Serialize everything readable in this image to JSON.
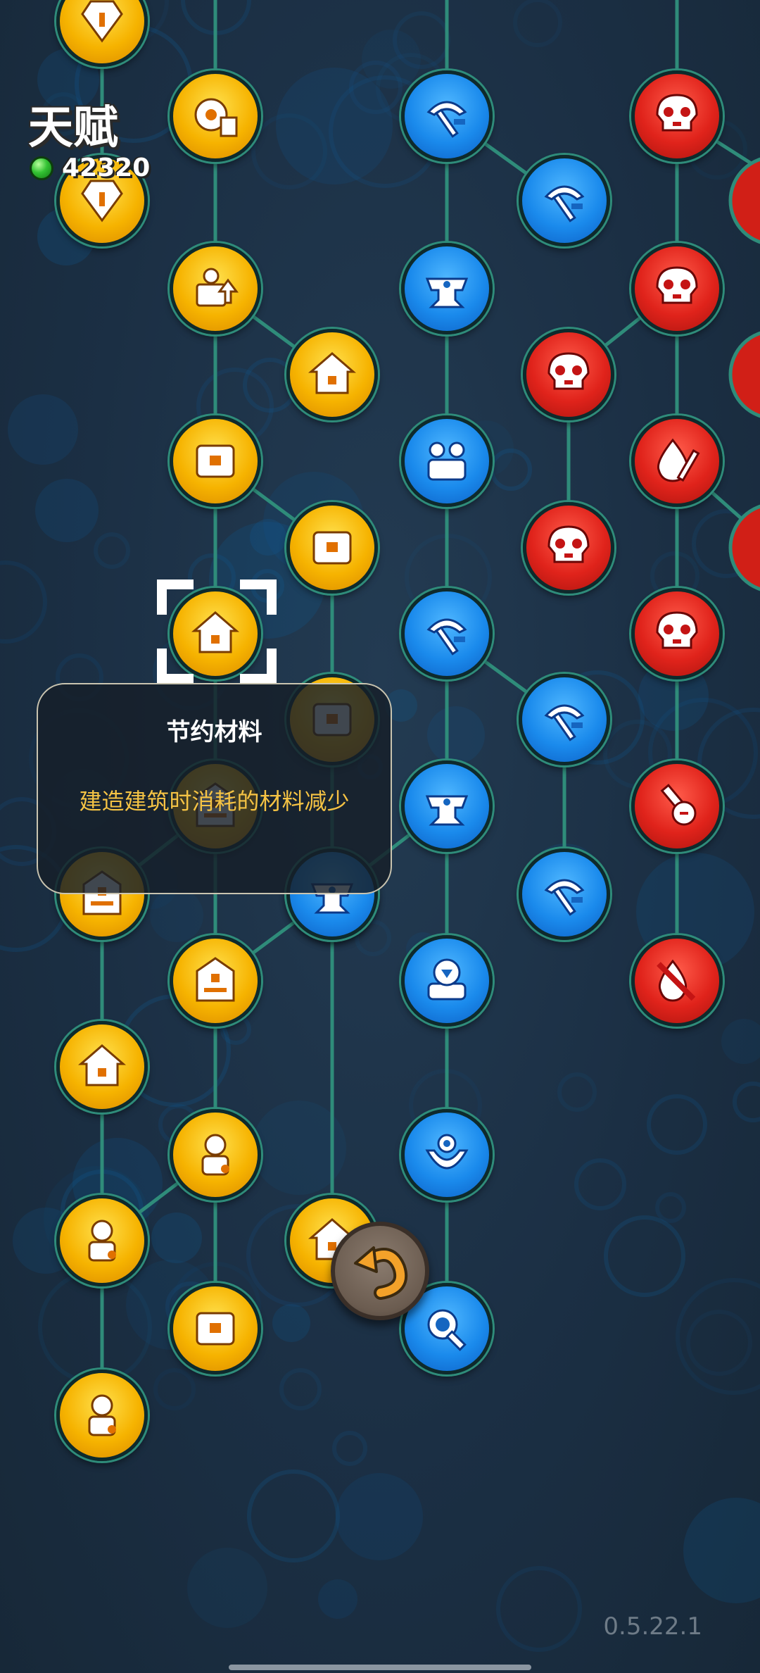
{
  "header": {
    "title": "天赋",
    "currency_icon": "green-gem-icon",
    "currency_value": "42320"
  },
  "tooltip": {
    "title": "节约材料",
    "description": "建造建筑时消耗的材料减少"
  },
  "version": "0.5.22.1",
  "colors": {
    "gold": "#f6b300",
    "blue": "#1a8aec",
    "red": "#e0231b",
    "link": "#2f8c7a",
    "tooltip_desc": "#f5c344"
  },
  "back_button": {
    "icon": "undo-arrow-icon"
  },
  "talents": [
    {
      "id": "g1",
      "color": "gold",
      "icon": "gem-bonus-icon"
    },
    {
      "id": "g2",
      "color": "gold",
      "icon": "gem-bonus-icon"
    },
    {
      "id": "g3",
      "color": "gold",
      "icon": "gear-exp-icon"
    },
    {
      "id": "g4",
      "color": "gold",
      "icon": "wood-bonus-icon"
    },
    {
      "id": "g5",
      "color": "gold",
      "icon": "house-upgrade-icon"
    },
    {
      "id": "g6",
      "color": "gold",
      "icon": "storage-icon"
    },
    {
      "id": "g7",
      "color": "gold",
      "icon": "storage-icon"
    },
    {
      "id": "g8",
      "color": "gold",
      "icon": "save-materials-icon"
    },
    {
      "id": "g9",
      "color": "gold",
      "icon": "storage-icon"
    },
    {
      "id": "g10",
      "color": "gold",
      "icon": "building-icon"
    },
    {
      "id": "g11",
      "color": "gold",
      "icon": "building-icon"
    },
    {
      "id": "g12",
      "color": "gold",
      "icon": "house-icon"
    },
    {
      "id": "g13",
      "color": "gold",
      "icon": "building-icon"
    },
    {
      "id": "g14",
      "color": "gold",
      "icon": "house-icon"
    },
    {
      "id": "g15",
      "color": "gold",
      "icon": "worker-icon"
    },
    {
      "id": "g16",
      "color": "gold",
      "icon": "worker-icon"
    },
    {
      "id": "g17",
      "color": "gold",
      "icon": "house-icon"
    },
    {
      "id": "g18",
      "color": "gold",
      "icon": "storage-icon"
    },
    {
      "id": "g19",
      "color": "gold",
      "icon": "worker-icon"
    },
    {
      "id": "b1",
      "color": "blue",
      "icon": "pickaxe-exp-icon"
    },
    {
      "id": "b2",
      "color": "blue",
      "icon": "pickaxe-exp-icon"
    },
    {
      "id": "b3",
      "color": "blue",
      "icon": "anvil-icon"
    },
    {
      "id": "b4",
      "color": "blue",
      "icon": "workers-icon"
    },
    {
      "id": "b5",
      "color": "blue",
      "icon": "pickaxe-plus-icon"
    },
    {
      "id": "b6",
      "color": "blue",
      "icon": "pickaxe-plus-icon"
    },
    {
      "id": "b7",
      "color": "blue",
      "icon": "anvil-stack-icon"
    },
    {
      "id": "b8",
      "color": "blue",
      "icon": "anvil-stack-icon"
    },
    {
      "id": "b9",
      "color": "blue",
      "icon": "pickaxe-plus-icon"
    },
    {
      "id": "b10",
      "color": "blue",
      "icon": "download-icon"
    },
    {
      "id": "b11",
      "color": "blue",
      "icon": "fountain-icon"
    },
    {
      "id": "b12",
      "color": "blue",
      "icon": "search-icon"
    },
    {
      "id": "r1",
      "color": "red",
      "icon": "skull-plus-icon"
    },
    {
      "id": "r2",
      "color": "red",
      "icon": "skull-plus-icon"
    },
    {
      "id": "r3",
      "color": "red",
      "icon": "skull-plus-icon"
    },
    {
      "id": "r4",
      "color": "red",
      "icon": "drop-sword-icon"
    },
    {
      "id": "r5",
      "color": "red",
      "icon": "skull-plus-icon"
    },
    {
      "id": "r6",
      "color": "red",
      "icon": "skull-fight-icon"
    },
    {
      "id": "r7",
      "color": "red",
      "icon": "sword-plus-icon"
    },
    {
      "id": "r8",
      "color": "red",
      "icon": "no-drop-icon"
    }
  ]
}
